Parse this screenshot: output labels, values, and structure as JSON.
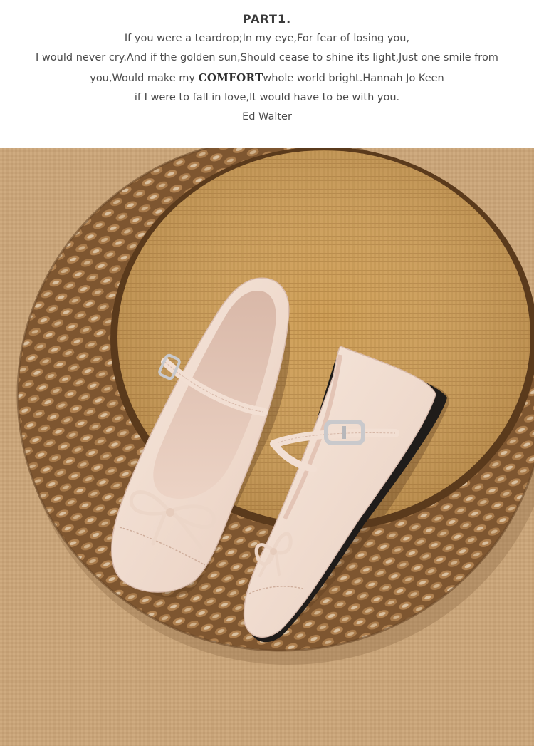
{
  "header": {
    "title": "PART1.",
    "line1": "If you were a teardrop;In my eye,For fear of losing you,",
    "line2": "I would never cry.And if the golden sun,Should cease to shine its light,Just one smile from",
    "line3_before": "you,Would make my ",
    "line3_emphasis": "COMFORT",
    "line3_after": "whole world bright.Hannah Jo Keen",
    "line4": "if I were to fall in love,It would have to be with you.",
    "line5": "Ed Walter"
  },
  "photo": {
    "subject": "pair of nude patent mary-jane flats with bows on a woven rattan mat",
    "colors": {
      "floor": "#c9a57a",
      "mat_outer": "#8a6238",
      "mat_inner": "#c4954f",
      "shoe": "#f1ddd0",
      "lining": "#e7c9bb",
      "sole": "#1f1c1a",
      "buckle": "#c9c9cc"
    }
  }
}
